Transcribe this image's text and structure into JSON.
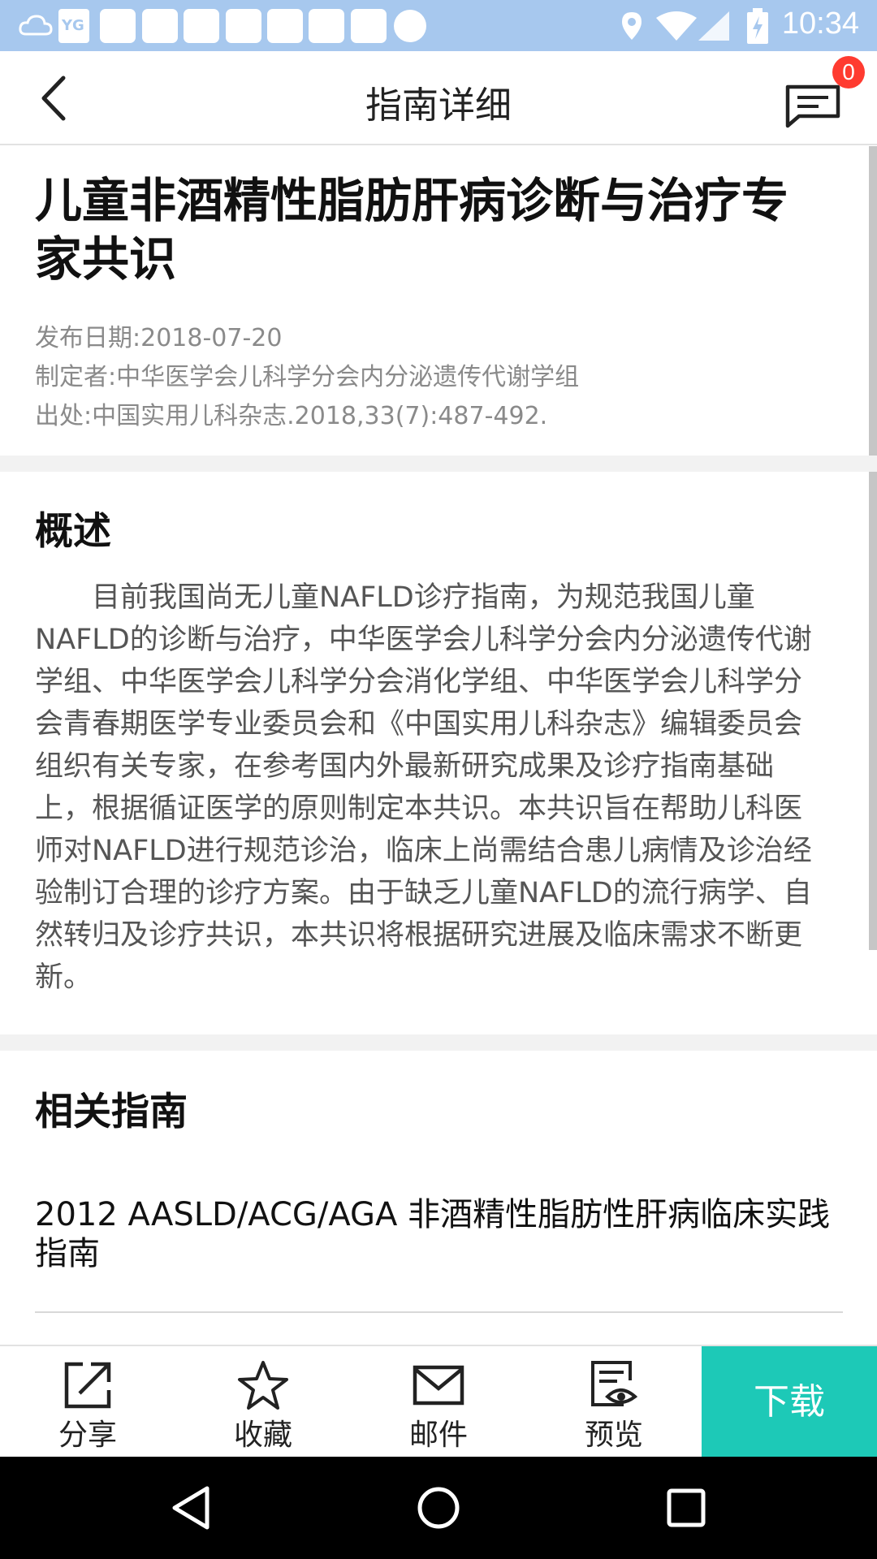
{
  "status_bar": {
    "time": "10:34",
    "icons": [
      "weather-cloud-icon",
      "app-notification-icon",
      "location-icon",
      "wifi-icon",
      "signal-icon",
      "battery-charging-icon"
    ]
  },
  "header": {
    "title": "指南详细",
    "back_icon": "chevron-left-icon",
    "message_icon": "message-icon",
    "message_badge": "0"
  },
  "guide": {
    "title": "儿童非酒精性脂肪肝病诊断与治疗专家共识",
    "publish_date": "发布日期:2018-07-20",
    "author": "制定者:中华医学会儿科学分会内分泌遗传代谢学组",
    "source": "出处:中国实用儿科杂志.2018,33(7):487-492."
  },
  "overview": {
    "heading": "概述",
    "body": "目前我国尚无儿童NAFLD诊疗指南，为规范我国儿童NAFLD的诊断与治疗，中华医学会儿科学分会内分泌遗传代谢学组、中华医学会儿科学分会消化学组、中华医学会儿科学分会青春期医学专业委员会和《中国实用儿科杂志》编辑委员会组织有关专家，在参考国内外最新研究成果及诊疗指南基础上，根据循证医学的原则制定本共识。本共识旨在帮助儿科医师对NAFLD进行规范诊治，临床上尚需结合患儿病情及诊治经验制订合理的诊疗方案。由于缺乏儿童NAFLD的流行病学、自然转归及诊疗共识，本共识将根据研究进展及临床需求不断更新。"
  },
  "related": {
    "heading": "相关指南",
    "items": [
      "2012 AASLD/ACG/AGA 非酒精性脂肪性肝病临床实践指南"
    ]
  },
  "actions": {
    "share": "分享",
    "favorite": "收藏",
    "email": "邮件",
    "preview": "预览",
    "download": "下载",
    "colors": {
      "download_bg": "#1dc9b7",
      "badge": "#ff3b30",
      "status_bar": "#a7c8ee"
    }
  }
}
